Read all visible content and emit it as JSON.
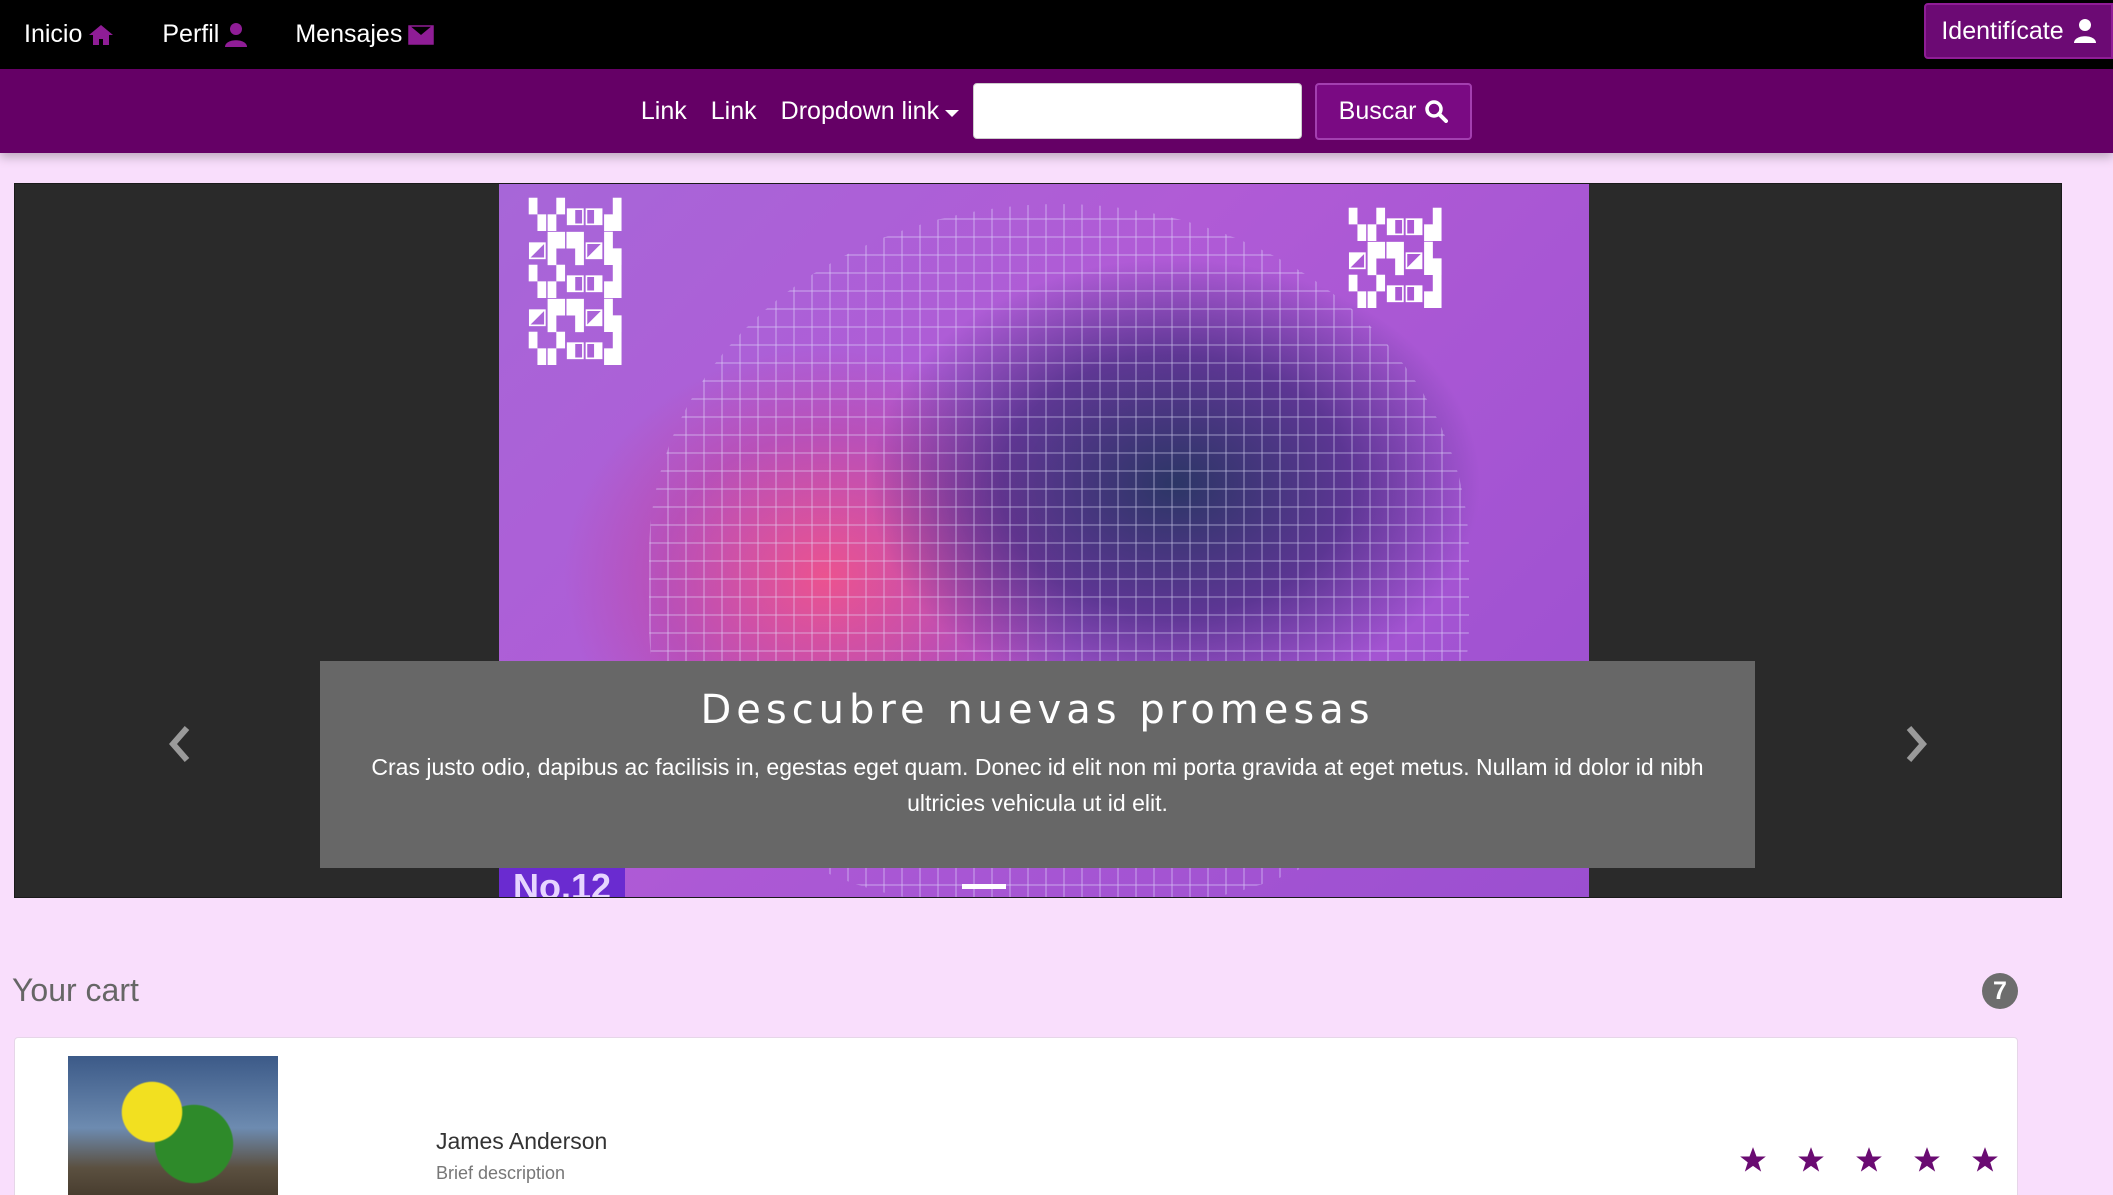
{
  "topbar": {
    "items": [
      {
        "label": "Inicio",
        "icon": "home-icon"
      },
      {
        "label": "Perfil",
        "icon": "user-icon"
      },
      {
        "label": "Mensajes",
        "icon": "envelope-icon"
      }
    ],
    "login_label": "Identifícate"
  },
  "subbar": {
    "links": [
      "Link",
      "Link"
    ],
    "dropdown_label": "Dropdown link",
    "search_value": "",
    "search_button": "Buscar"
  },
  "carousel": {
    "caption_title": "Descubre nuevas promesas",
    "caption_text": "Cras justo odio, dapibus ac facilisis in, egestas eget quam. Donec id elit non mi porta gravida at eget metus. Nullam id dolor id nibh ultricies vehicula ut id elit.",
    "slide_badge": "No.12"
  },
  "cart": {
    "title": "Your cart",
    "count": "7",
    "item": {
      "name": "James Anderson",
      "description": "Brief description",
      "rating": 5
    }
  },
  "colors": {
    "accent": "#650066",
    "background": "#f9defc",
    "topbar": "#000000"
  }
}
